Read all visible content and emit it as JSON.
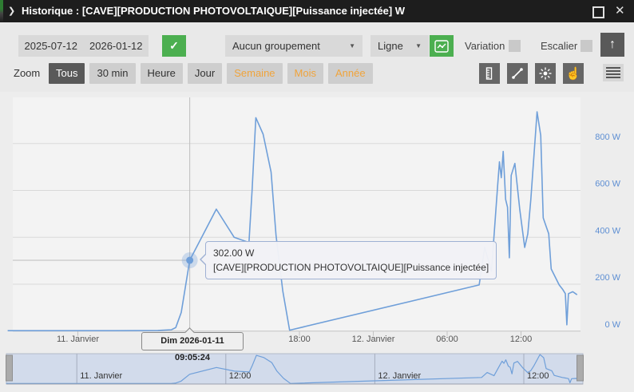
{
  "window": {
    "title": "Historique : [CAVE][PRODUCTION PHOTOVOLTAIQUE][Puissance injectée] W"
  },
  "icons": {
    "chevron": "❯",
    "close": "✕",
    "check": "✓",
    "caret_down": "▼",
    "up_arrow": "↑",
    "hand": "☝"
  },
  "toolbar": {
    "date_from": "2025-07-12",
    "date_to": "2026-01-12",
    "grouping_value": "Aucun groupement",
    "chart_type_value": "Ligne",
    "variation_label": "Variation",
    "variation_checked": false,
    "escalier_label": "Escalier",
    "escalier_checked": false
  },
  "zoombar": {
    "label": "Zoom",
    "buttons": [
      {
        "label": "Tous",
        "state": "active"
      },
      {
        "label": "30 min",
        "state": "normal"
      },
      {
        "label": "Heure",
        "state": "normal"
      },
      {
        "label": "Jour",
        "state": "normal"
      },
      {
        "label": "Semaine",
        "state": "orange"
      },
      {
        "label": "Mois",
        "state": "orange"
      },
      {
        "label": "Année",
        "state": "orange"
      }
    ]
  },
  "tooltip": {
    "value": "302.00 W",
    "series": "[CAVE][PRODUCTION PHOTOVOLTAIQUE][Puissance injectée]"
  },
  "crosshair_label": "Dim 2026-01-11 09:05:24",
  "colors": {
    "accent_green": "#4caf50",
    "orange_text": "#f0a43c",
    "line": "#6f9fd9",
    "y_label": "#5e8fd3",
    "x_label": "#555555",
    "grid": "#d9d9d9",
    "axis": "#c3c3c3",
    "crosshair": "#bdbdbd",
    "navigator_mask": "#d2dbeb",
    "navigator_grid": "#a5adbd",
    "handle": "#ababab"
  },
  "chart_data": {
    "type": "line",
    "title": "",
    "ylabel": "W",
    "x_unit": "hours from 2026-01-11 00:00",
    "xlim": [
      -5.7,
      40.83
    ],
    "ylim": [
      0,
      980
    ],
    "grid": true,
    "legend": "none",
    "y_ticks": [
      {
        "v": 0,
        "label": "0 W"
      },
      {
        "v": 200,
        "label": "200 W"
      },
      {
        "v": 400,
        "label": "400 W"
      },
      {
        "v": 600,
        "label": "600 W"
      },
      {
        "v": 800,
        "label": "800 W"
      }
    ],
    "x_ticks": [
      {
        "t": 0,
        "label": "11. Janvier"
      },
      {
        "t": 18,
        "label": "18:00"
      },
      {
        "t": 24,
        "label": "12. Janvier"
      },
      {
        "t": 30,
        "label": "06:00"
      },
      {
        "t": 36,
        "label": "12:00"
      }
    ],
    "navigator_x_ticks": [
      {
        "t": 0,
        "label": "11. Janvier"
      },
      {
        "t": 12,
        "label": "12:00"
      },
      {
        "t": 24,
        "label": "12. Janvier"
      },
      {
        "t": 36,
        "label": "12:00"
      }
    ],
    "marker": {
      "t": 9.09,
      "v": 302
    },
    "series": [
      {
        "name": "[CAVE][PRODUCTION PHOTOVOLTAIQUE][Puissance injectée]",
        "unit": "W",
        "points": [
          [
            -5.7,
            2
          ],
          [
            3,
            2
          ],
          [
            6.5,
            3
          ],
          [
            7.6,
            6
          ],
          [
            7.95,
            15
          ],
          [
            8.4,
            80
          ],
          [
            9.09,
            302
          ],
          [
            11.25,
            520
          ],
          [
            12.7,
            400
          ],
          [
            13.9,
            378
          ],
          [
            14.15,
            600
          ],
          [
            14.46,
            910
          ],
          [
            15.05,
            840
          ],
          [
            15.7,
            678
          ],
          [
            16.1,
            408
          ],
          [
            16.65,
            170
          ],
          [
            17.2,
            4
          ],
          [
            32.6,
            197
          ],
          [
            33.05,
            357
          ],
          [
            33.6,
            255
          ],
          [
            34.1,
            619
          ],
          [
            34.25,
            722
          ],
          [
            34.4,
            654
          ],
          [
            34.55,
            766
          ],
          [
            34.75,
            562
          ],
          [
            34.9,
            528
          ],
          [
            35.05,
            313
          ],
          [
            35.2,
            664
          ],
          [
            35.5,
            715
          ],
          [
            35.9,
            517
          ],
          [
            36.3,
            357
          ],
          [
            36.55,
            415
          ],
          [
            36.8,
            562
          ],
          [
            37.3,
            935
          ],
          [
            37.6,
            834
          ],
          [
            37.8,
            483
          ],
          [
            37.95,
            460
          ],
          [
            38.25,
            415
          ],
          [
            38.45,
            265
          ],
          [
            39.1,
            197
          ],
          [
            39.4,
            177
          ],
          [
            39.6,
            160
          ],
          [
            39.72,
            27
          ],
          [
            39.85,
            160
          ],
          [
            40.2,
            168
          ],
          [
            40.55,
            155
          ]
        ]
      }
    ]
  }
}
